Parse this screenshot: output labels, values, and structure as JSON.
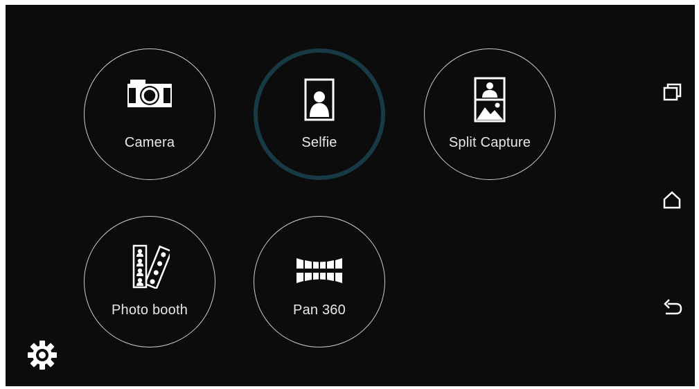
{
  "modes": [
    {
      "id": "camera",
      "label": "Camera",
      "icon": "camera-icon",
      "selected": false
    },
    {
      "id": "selfie",
      "label": "Selfie",
      "icon": "selfie-portrait-icon",
      "selected": true
    },
    {
      "id": "split",
      "label": "Split Capture",
      "icon": "split-capture-icon",
      "selected": false
    },
    {
      "id": "booth",
      "label": "Photo booth",
      "icon": "photo-booth-icon",
      "selected": false
    },
    {
      "id": "pan",
      "label": "Pan 360",
      "icon": "panorama-360-icon",
      "selected": false
    }
  ],
  "navigation": {
    "recent_icon": "recent-apps-icon",
    "home_icon": "home-icon",
    "back_icon": "back-icon"
  },
  "settings_icon": "gear-icon",
  "colors": {
    "background": "#0c0c0c",
    "circle_border": "#cfcfcf",
    "selected_ring": "#173a45",
    "text": "#e8e8e8"
  }
}
